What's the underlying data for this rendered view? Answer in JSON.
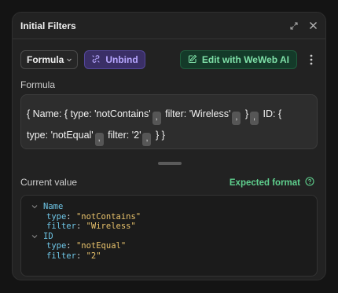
{
  "header": {
    "title": "Initial Filters",
    "icons": [
      "expand-icon",
      "close-icon"
    ]
  },
  "toolbar": {
    "mode_label": "Formula",
    "unbind_label": "Unbind",
    "ai_label": "Edit with WeWeb AI"
  },
  "formula": {
    "label": "Formula",
    "line1_a": "{ Name: { type: 'notContains'",
    "line1_b": " filter: 'Wireless'",
    "line1_c": " }",
    "line1_d": " ID: {",
    "line2_a": "type: 'notEqual'",
    "line2_b": " filter: '2'",
    "line2_c": " } }",
    "separator": ","
  },
  "current_value": {
    "label": "Current value",
    "expected_label": "Expected format",
    "tree": {
      "name_key": "Name",
      "name_type_key": "type",
      "name_type_val": "\"notContains\"",
      "name_filter_key": "filter",
      "name_filter_val": "\"Wireless\"",
      "id_key": "ID",
      "id_type_key": "type",
      "id_type_val": "\"notEqual\"",
      "id_filter_key": "filter",
      "id_filter_val": "\"2\""
    }
  },
  "colors": {
    "unbind": "#b7a7ff",
    "ai": "#7fe0a8",
    "key": "#6fc7e8",
    "string": "#e8c26b"
  }
}
